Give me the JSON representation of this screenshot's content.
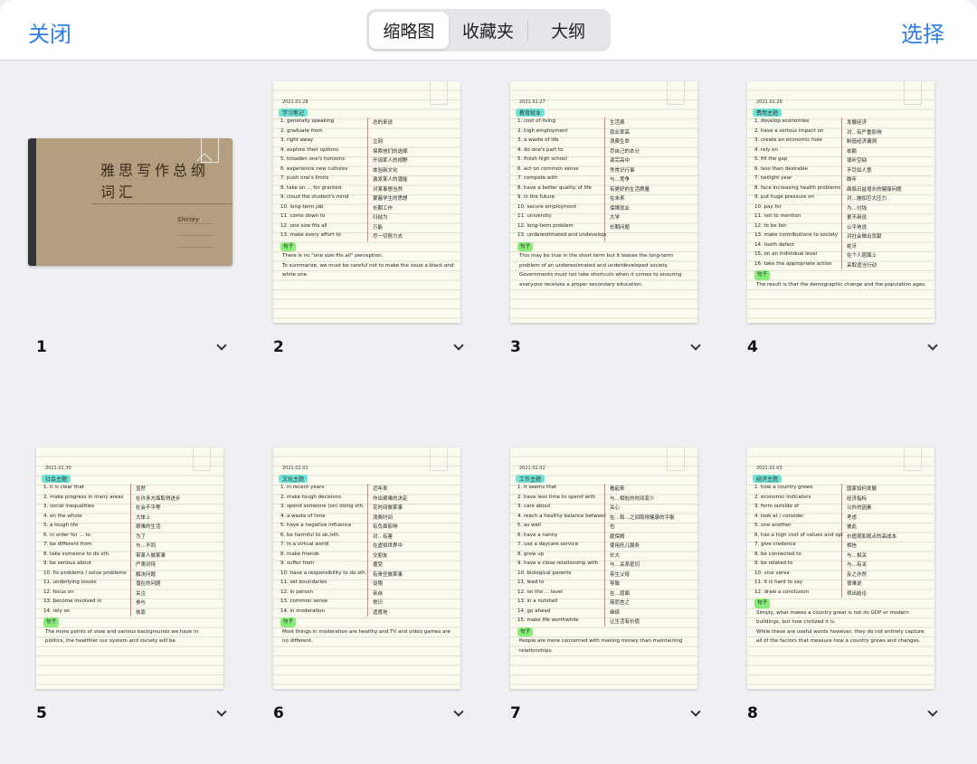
{
  "header": {
    "close": "关闭",
    "select": "选择",
    "tabs": [
      {
        "label": "缩略图",
        "active": true
      },
      {
        "label": "收藏夹"
      },
      {
        "label": "大纲"
      }
    ]
  },
  "accent": "#2f7fe6",
  "cover": {
    "number": "1",
    "title": "雅思写作总纲词汇",
    "author": "Shirley"
  },
  "pages": [
    {
      "number": "2",
      "date": "2021.01.28",
      "heading": "学习笔记",
      "lines": [
        [
          "1. generally speaking",
          "总的来说"
        ],
        [
          "2. graduate from",
          ""
        ],
        [
          "3. right away",
          "立刻"
        ],
        [
          "4. explore their options",
          "探索他们的选择"
        ],
        [
          "5. broaden one's horizons",
          "开阔某人的视野"
        ],
        [
          "6. experience new cultures",
          "体验新文化"
        ],
        [
          "7. push one's limits",
          "激发某人的潜能"
        ],
        [
          "8. take on ... for granted",
          "对某事想当然"
        ],
        [
          "9. cloud the student's mind",
          "蒙蔽学生的思想"
        ],
        [
          "10. long-term job",
          "长期工作"
        ],
        [
          "11. come down to",
          "归结为"
        ],
        [
          "12. one size fits all",
          "万能"
        ],
        [
          "13. make every effort to",
          "尽一切努力去"
        ]
      ],
      "sentences_label": "句子",
      "sentences": [
        "There is no \"one size fits all\" perception.",
        "To summarize, we must be careful not to make the issue a black and white one."
      ]
    },
    {
      "number": "3",
      "date": "2021.01.27",
      "heading": "教育就业",
      "lines": [
        [
          "1. cost of living",
          "生活费"
        ],
        [
          "2. high employment",
          "就业率高"
        ],
        [
          "3. a waste of life",
          "浪费生命"
        ],
        [
          "4. do one's part to",
          "尽自己的本分"
        ],
        [
          "5. finish high school",
          "读完高中"
        ],
        [
          "6. act on common sense",
          "凭常识行事"
        ],
        [
          "7. compete with",
          "与…竞争"
        ],
        [
          "8. have a better quality of life",
          "有更好的生活质量"
        ],
        [
          "9. in the future",
          "在未来"
        ],
        [
          "10. secure employment",
          "保障就业"
        ],
        [
          "11. university",
          "大学"
        ],
        [
          "12. long-term problem",
          "长期问题"
        ],
        [
          "13. underestimated and undeveloped society",
          ""
        ]
      ],
      "sentences_label": "句子",
      "sentences": [
        "This may be true in the short term but it leaves the long-term problem of an underestimated and underdeveloped society.",
        "Governments must not take shortcuts when it comes to ensuring everyone receives a proper secondary education."
      ]
    },
    {
      "number": "4",
      "date": "2021.01.29",
      "heading": "费用主题",
      "lines": [
        [
          "1. develop economies",
          "发展经济"
        ],
        [
          "2. have a serious impact on",
          "对…有严重影响"
        ],
        [
          "3. create an economic hole",
          "制造经济漏洞"
        ],
        [
          "4. rely on",
          "依赖"
        ],
        [
          "5. fill the gap",
          "填补空缺"
        ],
        [
          "6. less than desirable",
          "不尽如人意"
        ],
        [
          "7. twilight year",
          "晚年"
        ],
        [
          "8. face increasing health problems",
          "面临日益增长的健康问题"
        ],
        [
          "9. put huge pressure on",
          "对…施加巨大压力"
        ],
        [
          "10. pay for",
          "为…付钱"
        ],
        [
          "11. not to mention",
          "更不用说"
        ],
        [
          "12. to be fair",
          "公平地说"
        ],
        [
          "13. make contributions to society",
          "对社会做出贡献"
        ],
        [
          "14. tooth defect",
          "蛀牙"
        ],
        [
          "15. on an individual level",
          "在个人层面上"
        ],
        [
          "16. take the appropriate action",
          "采取适当行动"
        ]
      ],
      "sentences_label": "句子",
      "sentences": [
        "The result is that the demographic change and the population ages."
      ]
    },
    {
      "number": "5",
      "date": "2021.01.30",
      "heading": "社会主题",
      "lines": [
        [
          "1. it is clear that",
          "显然"
        ],
        [
          "2. make progress in many areas",
          "在许多方面取得进步"
        ],
        [
          "3. social inequalities",
          "社会不平等"
        ],
        [
          "4. on the whole",
          "大体上"
        ],
        [
          "5. a tough life",
          "艰难的生活"
        ],
        [
          "6. in order for ... to",
          "为了"
        ],
        [
          "7. be different from",
          "与…不同"
        ],
        [
          "8. take someone to do sth.",
          "带某人做某事"
        ],
        [
          "9. be serious about",
          "严肃对待"
        ],
        [
          "10. fix problems / solve problems",
          "解决问题"
        ],
        [
          "11. underlying issues",
          "潜在的问题"
        ],
        [
          "12. focus on",
          "关注"
        ],
        [
          "13. become involved in",
          "参与"
        ],
        [
          "14. rely on",
          "依靠"
        ]
      ],
      "sentences_label": "句子",
      "sentences": [
        "The more points of view and various backgrounds we have in politics, the healthier our system and society will be."
      ]
    },
    {
      "number": "6",
      "date": "2021.02.01",
      "heading": "文化主题",
      "lines": [
        [
          "1. in recent years",
          "近年来"
        ],
        [
          "2. make tough decisions",
          "作出艰难的决定"
        ],
        [
          "3. spend someone (on) doing sth.",
          "花时间做某事"
        ],
        [
          "4. a waste of time",
          "浪费时间"
        ],
        [
          "5. have a negative influence",
          "有负面影响"
        ],
        [
          "6. be harmful to sb./sth.",
          "对…有害"
        ],
        [
          "7. in a virtual world",
          "在虚拟世界中"
        ],
        [
          "8. make friends",
          "交朋友"
        ],
        [
          "9. suffer from",
          "遭受"
        ],
        [
          "10. have a responsibility to do sth.",
          "有责任做某事"
        ],
        [
          "11. set boundaries",
          "设限"
        ],
        [
          "12. in person",
          "亲自"
        ],
        [
          "13. common sense",
          "常识"
        ],
        [
          "14. in moderation",
          "适度地"
        ]
      ],
      "sentences_label": "句子",
      "sentences": [
        "Most things in moderation are healthy and TV and video games are no different."
      ]
    },
    {
      "number": "7",
      "date": "2021.02.02",
      "heading": "工作主题",
      "lines": [
        [
          "1. it seems that",
          "看起来"
        ],
        [
          "2. have less time to spend with",
          "与…相处的时间变少"
        ],
        [
          "3. care about",
          "关心"
        ],
        [
          "4. reach a healthy balance between ... and",
          "在…和…之间取得健康的平衡"
        ],
        [
          "5. as well",
          "也"
        ],
        [
          "6. have a nanny",
          "雇保姆"
        ],
        [
          "7. use a daycare service",
          "使用托儿服务"
        ],
        [
          "8. grow up",
          "长大"
        ],
        [
          "9. have a close relationship with",
          "与…关系密切"
        ],
        [
          "10. biological parents",
          "亲生父母"
        ],
        [
          "11. lead to",
          "导致"
        ],
        [
          "12. on the ... level",
          "在…层面"
        ],
        [
          "13. in a nutshell",
          "简而言之"
        ],
        [
          "14. go ahead",
          "继续"
        ],
        [
          "15. make life worthwhile",
          "让生活有价值"
        ]
      ],
      "sentences_label": "句子",
      "sentences": [
        "People are more concerned with making money than maintaining relationships."
      ]
    },
    {
      "number": "8",
      "date": "2021.02.03",
      "heading": "经济主题",
      "lines": [
        [
          "1. how a country grows",
          "国家如何发展"
        ],
        [
          "2. economic indicators",
          "经济指标"
        ],
        [
          "3. form outside of",
          "以外的因素"
        ],
        [
          "4. look at / consider",
          "考虑"
        ],
        [
          "5. one another",
          "彼此"
        ],
        [
          "6. has a high cost of values and opinions",
          "价值观和观点的高成本"
        ],
        [
          "7. give credence",
          "相信"
        ],
        [
          "8. be connected to",
          "与…相关"
        ],
        [
          "9. be related to",
          "与…有关"
        ],
        [
          "10. vice versa",
          "反之亦然"
        ],
        [
          "11. it is hard to say",
          "很难说"
        ],
        [
          "12. draw a conclusion",
          "得出结论"
        ]
      ],
      "sentences_label": "句子",
      "sentences": [
        "Simply, what makes a country great is not its GDP or modern buildings, but how civilized it is.",
        "While these are useful words however, they do not entirely capture all of the factors that measure how a country grows and changes."
      ]
    }
  ]
}
